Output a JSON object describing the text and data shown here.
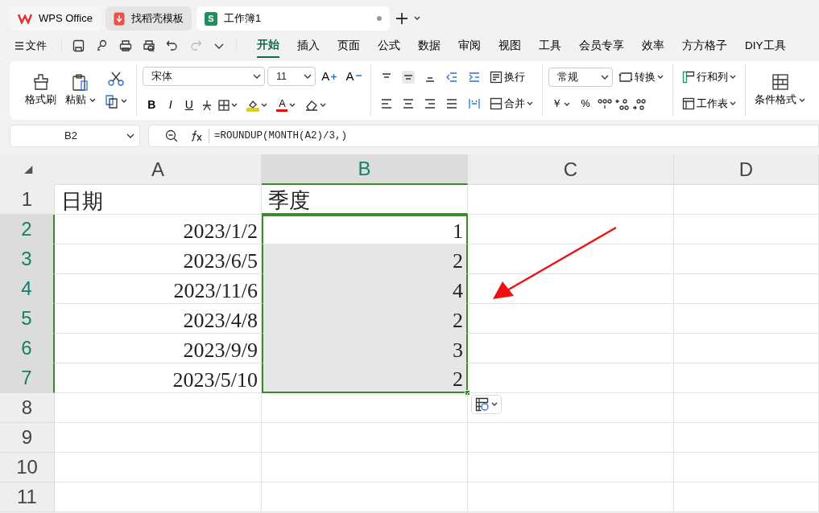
{
  "app_tabs": [
    {
      "label": "WPS Office",
      "kind": "home",
      "selected": false
    },
    {
      "label": "找稻壳模板",
      "kind": "template",
      "selected": false
    },
    {
      "label": "工作簿1",
      "kind": "sheet",
      "badge": "S",
      "selected": true,
      "unsaved": true
    }
  ],
  "menu": {
    "file": "文件",
    "tabs": [
      {
        "label": "开始",
        "selected": true
      },
      {
        "label": "插入",
        "selected": false
      },
      {
        "label": "页面",
        "selected": false
      },
      {
        "label": "公式",
        "selected": false
      },
      {
        "label": "数据",
        "selected": false
      },
      {
        "label": "审阅",
        "selected": false
      },
      {
        "label": "视图",
        "selected": false
      },
      {
        "label": "工具",
        "selected": false
      },
      {
        "label": "会员专享",
        "selected": false
      },
      {
        "label": "效率",
        "selected": false
      },
      {
        "label": "方方格子",
        "selected": false
      },
      {
        "label": "DIY工具",
        "selected": false
      }
    ]
  },
  "ribbon": {
    "format_painter": "格式刷",
    "paste": "粘贴",
    "font": "宋体",
    "font_size": "11",
    "size_buttons": [
      {
        "label": "A",
        "kind": "grow"
      },
      {
        "label": "A",
        "kind": "shrink"
      }
    ],
    "style_buttons": [
      {
        "label": "B",
        "kind": "bold"
      },
      {
        "label": "I",
        "kind": "italic"
      },
      {
        "label": "U",
        "kind": "underline"
      }
    ],
    "font_color": "A",
    "wrap": "换行",
    "merge": "合并",
    "number_format": "常规",
    "convert": "转换",
    "currency": "￥",
    "percent": "%",
    "rows_cols": "行和列",
    "worksheet": "工作表",
    "conditional_format": "条件格式"
  },
  "formula_bar": {
    "cell_ref": "B2",
    "formula": "=ROUNDUP(MONTH(A2)/3,)"
  },
  "sheet": {
    "columns": [
      {
        "label": "A",
        "selected": false
      },
      {
        "label": "B",
        "selected": true
      },
      {
        "label": "C",
        "selected": false
      },
      {
        "label": "D",
        "selected": false
      }
    ],
    "rows": [
      {
        "number": "1",
        "selected": false,
        "kind": "text",
        "cells": [
          "日期",
          "季度"
        ]
      },
      {
        "number": "2",
        "selected": true,
        "kind": "number",
        "cells": [
          "2023/1/2",
          "1"
        ]
      },
      {
        "number": "3",
        "selected": true,
        "kind": "number",
        "cells": [
          "2023/6/5",
          "2"
        ]
      },
      {
        "number": "4",
        "selected": true,
        "kind": "number",
        "cells": [
          "2023/11/6",
          "4"
        ]
      },
      {
        "number": "5",
        "selected": true,
        "kind": "number",
        "cells": [
          "2023/4/8",
          "2"
        ]
      },
      {
        "number": "6",
        "selected": true,
        "kind": "number",
        "cells": [
          "2023/9/9",
          "3"
        ]
      },
      {
        "number": "7",
        "selected": true,
        "kind": "number",
        "cells": [
          "2023/5/10",
          "2"
        ]
      },
      {
        "number": "8",
        "selected": false,
        "kind": "empty",
        "cells": []
      },
      {
        "number": "9",
        "selected": false,
        "kind": "empty",
        "cells": []
      },
      {
        "number": "10",
        "selected": false,
        "kind": "empty",
        "cells": []
      },
      {
        "number": "11",
        "selected": false,
        "kind": "empty",
        "cells": []
      }
    ]
  }
}
